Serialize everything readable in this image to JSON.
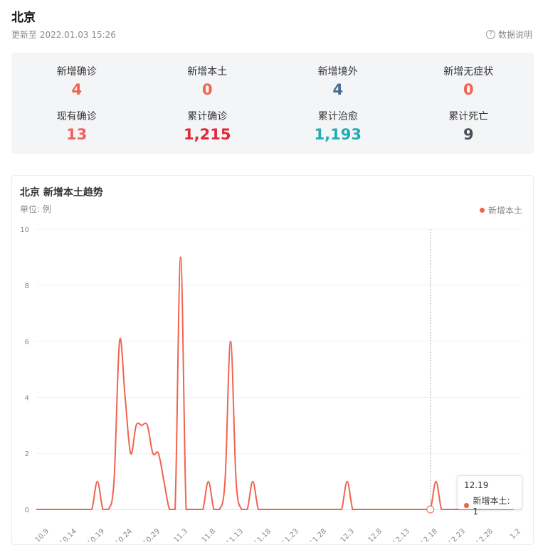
{
  "header": {
    "city": "北京",
    "updated": "更新至 2022.01.03 15:26",
    "help_label": "数据说明",
    "help_icon": "question-circle-icon"
  },
  "stats": [
    {
      "label": "新增确诊",
      "value": "4",
      "color": "#f0634f"
    },
    {
      "label": "新增本土",
      "value": "0",
      "color": "#f0634f"
    },
    {
      "label": "新增境外",
      "value": "4",
      "color": "#476a92"
    },
    {
      "label": "新增无症状",
      "value": "0",
      "color": "#f0634f"
    },
    {
      "label": "现有确诊",
      "value": "13",
      "color": "#f25e5e"
    },
    {
      "label": "累计确诊",
      "value": "1,215",
      "color": "#e0283a"
    },
    {
      "label": "累计治愈",
      "value": "1,193",
      "color": "#1eabb5"
    },
    {
      "label": "累计死亡",
      "value": "9",
      "color": "#4b4f5a"
    }
  ],
  "chart_panel": {
    "title": "北京 新增本土趋势",
    "unit": "单位: 例",
    "legend": "新增本土",
    "line_color": "#f0634f"
  },
  "chart_data": {
    "type": "line",
    "ylim": [
      0,
      10
    ],
    "yticks": [
      0,
      2,
      4,
      6,
      8,
      10
    ],
    "xticklabels": [
      "10.9",
      "10.14",
      "10.19",
      "10.24",
      "10.29",
      "11.3",
      "11.8",
      "11.13",
      "11.18",
      "11.23",
      "11.28",
      "12.3",
      "12.8",
      "12.13",
      "12.18",
      "12.23",
      "12.28",
      "1.2"
    ],
    "x": [
      "10.9",
      "10.10",
      "10.11",
      "10.12",
      "10.13",
      "10.14",
      "10.15",
      "10.16",
      "10.17",
      "10.18",
      "10.19",
      "10.20",
      "10.21",
      "10.22",
      "10.23",
      "10.24",
      "10.25",
      "10.26",
      "10.27",
      "10.28",
      "10.29",
      "10.30",
      "10.31",
      "11.1",
      "11.2",
      "11.3",
      "11.4",
      "11.5",
      "11.6",
      "11.7",
      "11.8",
      "11.9",
      "11.10",
      "11.11",
      "11.12",
      "11.13",
      "11.14",
      "11.15",
      "11.16",
      "11.17",
      "11.18",
      "11.19",
      "11.20",
      "11.21",
      "11.22",
      "11.23",
      "11.24",
      "11.25",
      "11.26",
      "11.27",
      "11.28",
      "11.29",
      "11.30",
      "12.1",
      "12.2",
      "12.3",
      "12.4",
      "12.5",
      "12.6",
      "12.7",
      "12.8",
      "12.9",
      "12.10",
      "12.11",
      "12.12",
      "12.13",
      "12.14",
      "12.15",
      "12.16",
      "12.17",
      "12.18",
      "12.19",
      "12.20",
      "12.21",
      "12.22",
      "12.23",
      "12.24",
      "12.25",
      "12.26",
      "12.27",
      "12.28",
      "12.29",
      "12.30",
      "12.31",
      "1.1",
      "1.2",
      "1.3"
    ],
    "series": [
      {
        "name": "新增本土",
        "values": [
          0,
          0,
          0,
          0,
          0,
          0,
          0,
          0,
          0,
          0,
          0,
          1,
          0,
          0,
          1,
          6,
          4,
          2,
          3,
          3,
          3,
          2,
          2,
          1,
          0,
          0,
          9,
          0,
          0,
          0,
          0,
          1,
          0,
          0,
          1,
          6,
          1,
          0,
          0,
          1,
          0,
          0,
          0,
          0,
          0,
          0,
          0,
          0,
          0,
          0,
          0,
          0,
          0,
          0,
          0,
          0,
          1,
          0,
          0,
          0,
          0,
          0,
          0,
          0,
          0,
          0,
          0,
          0,
          0,
          0,
          0,
          0,
          1,
          0,
          0,
          0,
          0,
          0,
          0,
          0,
          0,
          0,
          0,
          0,
          0,
          0,
          0
        ]
      }
    ],
    "grid": true,
    "crosshair_at": "12.19",
    "tooltip": {
      "date": "12.19",
      "label": "新增本土: 1"
    }
  }
}
